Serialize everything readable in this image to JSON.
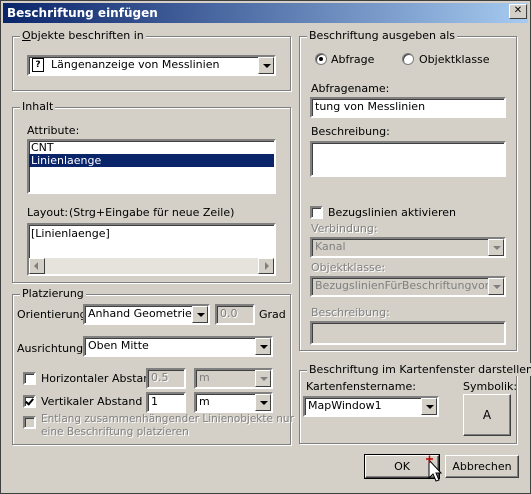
{
  "window": {
    "title": "Beschriftung einfügen",
    "close_glyph": "✕"
  },
  "objects_group": {
    "label": "Objekte beschriften in",
    "selected": "Längenanzeige von Messlinien",
    "icon_glyph": "?"
  },
  "content_group": {
    "label": "Inhalt",
    "attribute_label": "Attribute:",
    "attributes": [
      "CNT",
      "Linienlaenge"
    ],
    "layout_label": "Layout:",
    "layout_hint": "(Strg+Eingabe für neue Zeile)",
    "layout_value": "[Linienlaenge]"
  },
  "placement_group": {
    "label": "Platzierung",
    "orientation_label": "Orientierung:",
    "orientation_value": "Anhand Geometrie",
    "angle_value": "0.0",
    "angle_unit": "Grad",
    "alignment_label": "Ausrichtung:",
    "alignment_value": "Oben Mitte",
    "horizontal_label": "Horizontaler Abstand",
    "horizontal_value": "0.5",
    "horizontal_unit": "m",
    "vertical_label": "Vertikaler Abstand",
    "vertical_value": "1",
    "vertical_unit": "m",
    "along_label_line1": "Entlang zusammenhängender Linienobjekte nur",
    "along_label_line2": "eine Beschriftung platzieren"
  },
  "output_group": {
    "label": "Beschriftung ausgeben als",
    "radio_query": "Abfrage",
    "radio_class": "Objektklasse",
    "query_name_label": "Abfragename:",
    "query_name_value": "tung von  Messlinien",
    "description_label": "Beschreibung:",
    "description_value": "",
    "ref_lines_label": "Bezugslinien aktivieren",
    "connection_label": "Verbindung:",
    "connection_value": "Kanal",
    "object_class_label": "Objektklasse:",
    "object_class_value": "BezugslinienFürBeschriftungvonLäng",
    "description2_label": "Beschreibung:",
    "description2_value": ""
  },
  "map_group": {
    "label": "Beschriftung im Kartenfenster darstellen",
    "window_name_label": "Kartenfenstername:",
    "window_name_value": "MapWindow1",
    "symbol_label": "Symbolik:",
    "symbol_button": "A"
  },
  "buttons": {
    "ok": "OK",
    "cancel": "Abbrechen"
  }
}
